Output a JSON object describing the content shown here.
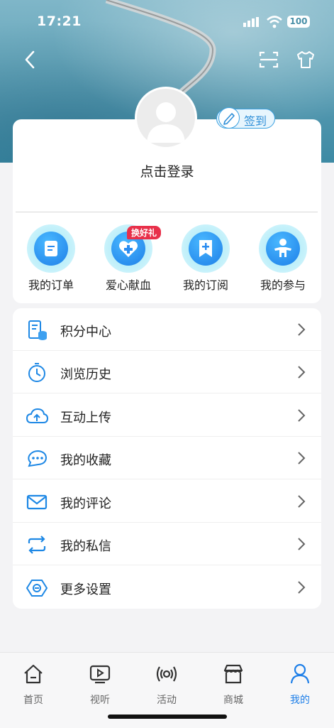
{
  "status_bar": {
    "time": "17:21",
    "battery": "100"
  },
  "profile": {
    "login_prompt": "点击登录",
    "checkin_label": "签到"
  },
  "quick_actions": [
    {
      "label": "我的订单",
      "icon": "order-icon"
    },
    {
      "label": "爱心献血",
      "icon": "blood-donation-icon",
      "badge": "换好礼"
    },
    {
      "label": "我的订阅",
      "icon": "subscription-icon"
    },
    {
      "label": "我的参与",
      "icon": "participation-icon"
    }
  ],
  "menu": [
    {
      "label": "积分中心",
      "icon": "points-icon"
    },
    {
      "label": "浏览历史",
      "icon": "history-icon"
    },
    {
      "label": "互动上传",
      "icon": "upload-icon"
    },
    {
      "label": "我的收藏",
      "icon": "favorites-icon"
    },
    {
      "label": "我的评论",
      "icon": "comment-icon"
    },
    {
      "label": "我的私信",
      "icon": "message-icon"
    },
    {
      "label": "更多设置",
      "icon": "settings-icon"
    }
  ],
  "tabs": [
    {
      "label": "首页",
      "icon": "home-icon"
    },
    {
      "label": "视听",
      "icon": "video-icon"
    },
    {
      "label": "活动",
      "icon": "broadcast-icon"
    },
    {
      "label": "商城",
      "icon": "store-icon"
    },
    {
      "label": "我的",
      "icon": "profile-icon",
      "active": true
    }
  ],
  "colors": {
    "accent": "#1e7fe8",
    "badge": "#e8304a"
  }
}
